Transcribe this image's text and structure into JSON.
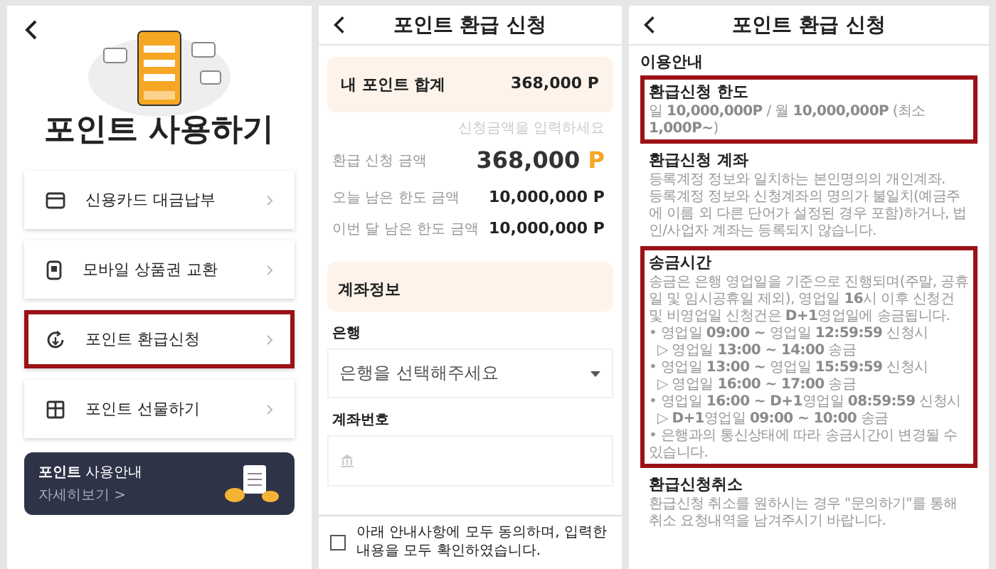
{
  "menu_screen": {
    "title": "포인트 사용하기",
    "items": [
      {
        "label": "신용카드 대금납부",
        "kind": "card",
        "highlighted": false
      },
      {
        "label": "모바일 상품권 교환",
        "kind": "phone",
        "highlighted": false
      },
      {
        "label": "포인트 환급신청",
        "kind": "refund",
        "highlighted": true
      },
      {
        "label": "포인트 선물하기",
        "kind": "gift",
        "highlighted": false
      }
    ],
    "banner": {
      "title": "**포인트** 사용안내",
      "link": "자세히보기 >"
    }
  },
  "refund_screen": {
    "title": "포인트 환급 신청",
    "total": {
      "label": "내 포인트 합계",
      "value": "368,000",
      "unit": "P"
    },
    "amount": {
      "label": "환급 신청 금액",
      "placeholder": "신청금액을 입력하세요",
      "value": "368,000",
      "unit": "P"
    },
    "limits": [
      {
        "label": "오늘 남은 한도 금액",
        "value": "10,000,000",
        "unit": "P"
      },
      {
        "label": "이번 달 남은 한도 금액",
        "value": "10,000,000",
        "unit": "P"
      }
    ],
    "account_section": "계좌정보",
    "bank_label": "은행",
    "bank_select": "은행을 선택해주세요",
    "account_label": "계좌번호",
    "agree": {
      "text": "아래 안내사항에 모두 동의하며, 입력한 내용을 모두 확인하였습니다.",
      "checked": false
    }
  },
  "guide_screen": {
    "title": "포인트 환급 신청",
    "heading": "이용안내",
    "sections": [
      {
        "title": "환급신청 한도",
        "highlighted": true,
        "paragraphs": [
          {
            "kind": "text",
            "text": "일 **10,000,000P** / 월 **10,000,000P** (최소 **1,000P~**)"
          }
        ]
      },
      {
        "title": "환급신청 계좌",
        "highlighted": false,
        "paragraphs": [
          {
            "kind": "text",
            "text": "등록계정 정보와 일치하는 본인명의의 개인계좌."
          },
          {
            "kind": "text",
            "text": "등록계정 정보와 신청계좌의 명의가 불일치(예금주에 이름 외 다른 단어가 설정된 경우 포함)하거나, 법인/사업자 계좌는 등록되지 않습니다."
          }
        ]
      },
      {
        "title": "송금시간",
        "highlighted": true,
        "paragraphs": [
          {
            "kind": "text",
            "text": "송금은 은행 영업일을 기준으로 진행되며(주말, 공휴일 및 임시공휴일 제외), 영업일 **16**시 이후 신청건 및 비영업일 신청건은 **D+1**영업일에 송금됩니다."
          },
          {
            "kind": "bullet",
            "text": "• 영업일 **09:00 ~** 영업일 **12:59:59** 신청시"
          },
          {
            "kind": "sub",
            "text": "▷ 영업일 **13:00 ~ 14:00** 송금"
          },
          {
            "kind": "bullet",
            "text": "• 영업일 **13:00 ~** 영업일 **15:59:59** 신청시"
          },
          {
            "kind": "sub",
            "text": "▷ 영업일 **16:00 ~ 17:00** 송금"
          },
          {
            "kind": "bullet",
            "text": "• 영업일 **16:00 ~ D+1**영업일 **08:59:59** 신청시"
          },
          {
            "kind": "sub",
            "text": "▷ **D+1**영업일 **09:00 ~ 10:00** 송금"
          },
          {
            "kind": "bullet",
            "text": "• 은행과의 통신상태에 따라 송금시간이 변경될 수 있습니다."
          }
        ]
      },
      {
        "title": "환급신청취소",
        "highlighted": false,
        "paragraphs": [
          {
            "kind": "text",
            "text": "환급신청 취소를 원하시는 경우 \"문의하기\"를 통해 취소 요청내역을 남겨주시기 바랍니다."
          }
        ]
      }
    ]
  }
}
